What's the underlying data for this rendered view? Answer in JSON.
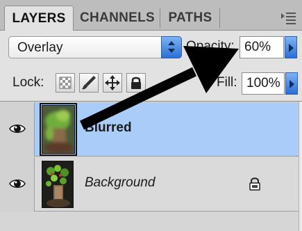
{
  "tabs": [
    "LAYERS",
    "CHANNELS",
    "PATHS"
  ],
  "active_tab": "LAYERS",
  "blend_mode": {
    "value": "Overlay"
  },
  "opacity": {
    "label": "Opacity:",
    "value": "60%"
  },
  "fill": {
    "label": "Fill:",
    "value": "100%"
  },
  "lock": {
    "label": "Lock:",
    "buttons": [
      "lock-transparent-pixels-icon",
      "lock-image-pixels-icon",
      "lock-position-icon",
      "lock-all-icon"
    ]
  },
  "layers": [
    {
      "name": "Blurred",
      "selected": true,
      "visible": true,
      "locked": false
    },
    {
      "name": "Background",
      "selected": false,
      "visible": true,
      "locked": true
    }
  ],
  "annotation": {
    "type": "arrow",
    "color": "#000000",
    "points_to": "opacity-field"
  },
  "colors": {
    "selection": "#a9cdf8",
    "accent_button": "#2a6fd6",
    "panel": "#d6d6d6"
  }
}
